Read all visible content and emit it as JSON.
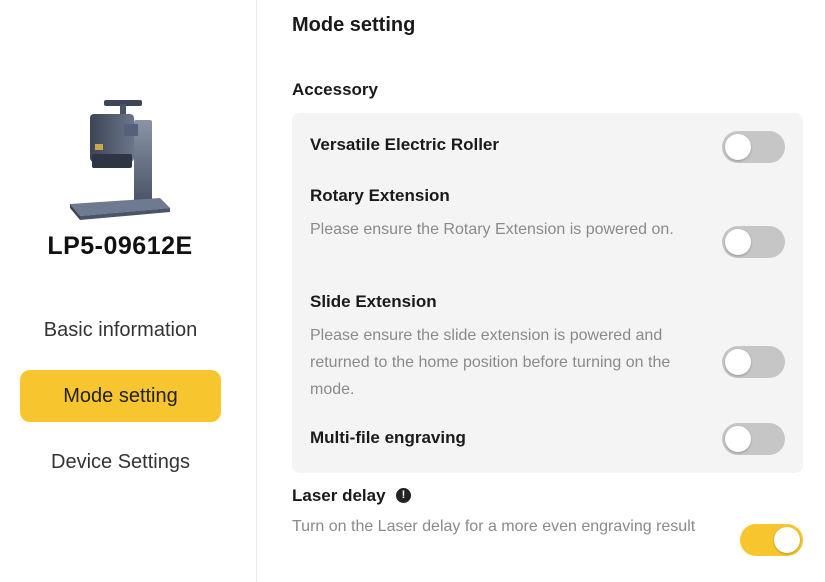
{
  "sidebar": {
    "device_name": "LP5-09612E",
    "nav": [
      {
        "label": "Basic information",
        "active": false
      },
      {
        "label": "Mode setting",
        "active": true
      },
      {
        "label": "Device Settings",
        "active": false
      }
    ]
  },
  "main": {
    "title": "Mode setting",
    "accessory": {
      "title": "Accessory",
      "items": [
        {
          "title": "Versatile Electric Roller",
          "description": "",
          "enabled": false
        },
        {
          "title": "Rotary Extension",
          "description": "Please ensure the Rotary Extension is powered on.",
          "enabled": false
        },
        {
          "title": "Slide Extension",
          "description": "Please ensure the slide extension is powered and returned to the home position before turning on the mode.",
          "enabled": false
        },
        {
          "title": "Multi-file engraving",
          "description": "",
          "enabled": false
        }
      ]
    },
    "laser_delay": {
      "title": "Laser delay",
      "info_icon": "!",
      "description": "Turn on the Laser delay for a more even engraving result",
      "enabled": true
    }
  },
  "colors": {
    "accent": "#f7c52e",
    "toggle_off": "#c6c6c6",
    "card_bg": "#f4f4f4",
    "muted_text": "#8a8a8a"
  }
}
